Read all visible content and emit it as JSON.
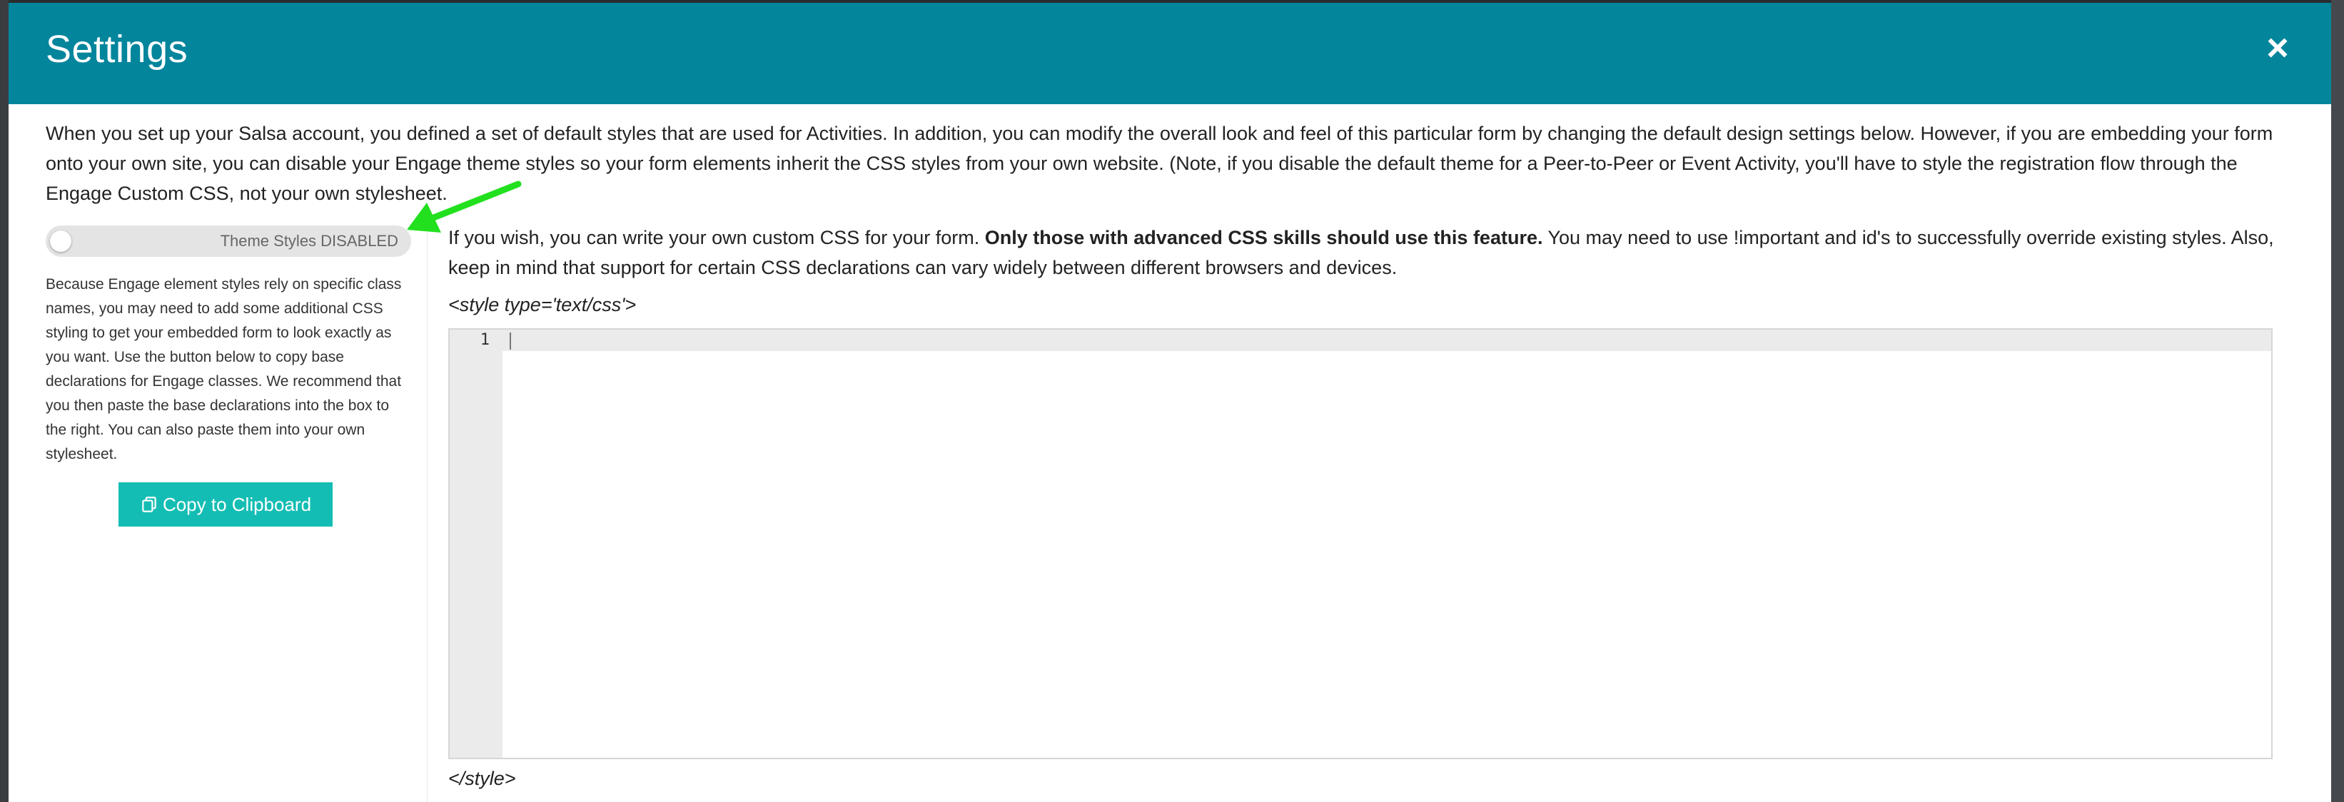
{
  "modal": {
    "title": "Settings",
    "close_label": "×"
  },
  "intro": "When you set up your Salsa account, you defined a set of default styles that are used for Activities. In addition, you can modify the overall look and feel of this particular form by changing the default design settings below. However, if you are embedding your form onto your own site, you can disable your Engage theme styles so your form elements inherit the CSS styles from your own website. (Note, if you disable the default theme for a Peer-to-Peer or Event Activity, you'll have to style the registration flow through the Engage Custom CSS, not your own stylesheet.",
  "theme_toggle": {
    "label": "Theme Styles DISABLED",
    "state": "off"
  },
  "left_description": "Because Engage element styles rely on specific class names, you may need to add some additional CSS styling to get your embedded form to look exactly as you want. Use the button below to copy base declarations for Engage classes. We recommend that you then paste the base declarations into the box to the right. You can also paste them into your own stylesheet.",
  "copy_button": {
    "label": "Copy to Clipboard",
    "icon": "copy-icon"
  },
  "custom_css": {
    "desc_prefix": "If you wish, you can write your own custom CSS for your form. ",
    "desc_bold": "Only those with advanced CSS skills should use this feature.",
    "desc_suffix": " You may need to use !important and id's to successfully override existing styles. Also, keep in mind that support for certain CSS declarations can vary widely between different browsers and devices.",
    "open_tag": "<style type='text/css'>",
    "close_tag": "</style>",
    "editor_value": "",
    "line_numbers": [
      "1"
    ]
  },
  "colors": {
    "header": "#03859c",
    "button": "#14bdb4",
    "arrow": "#22e01e"
  }
}
